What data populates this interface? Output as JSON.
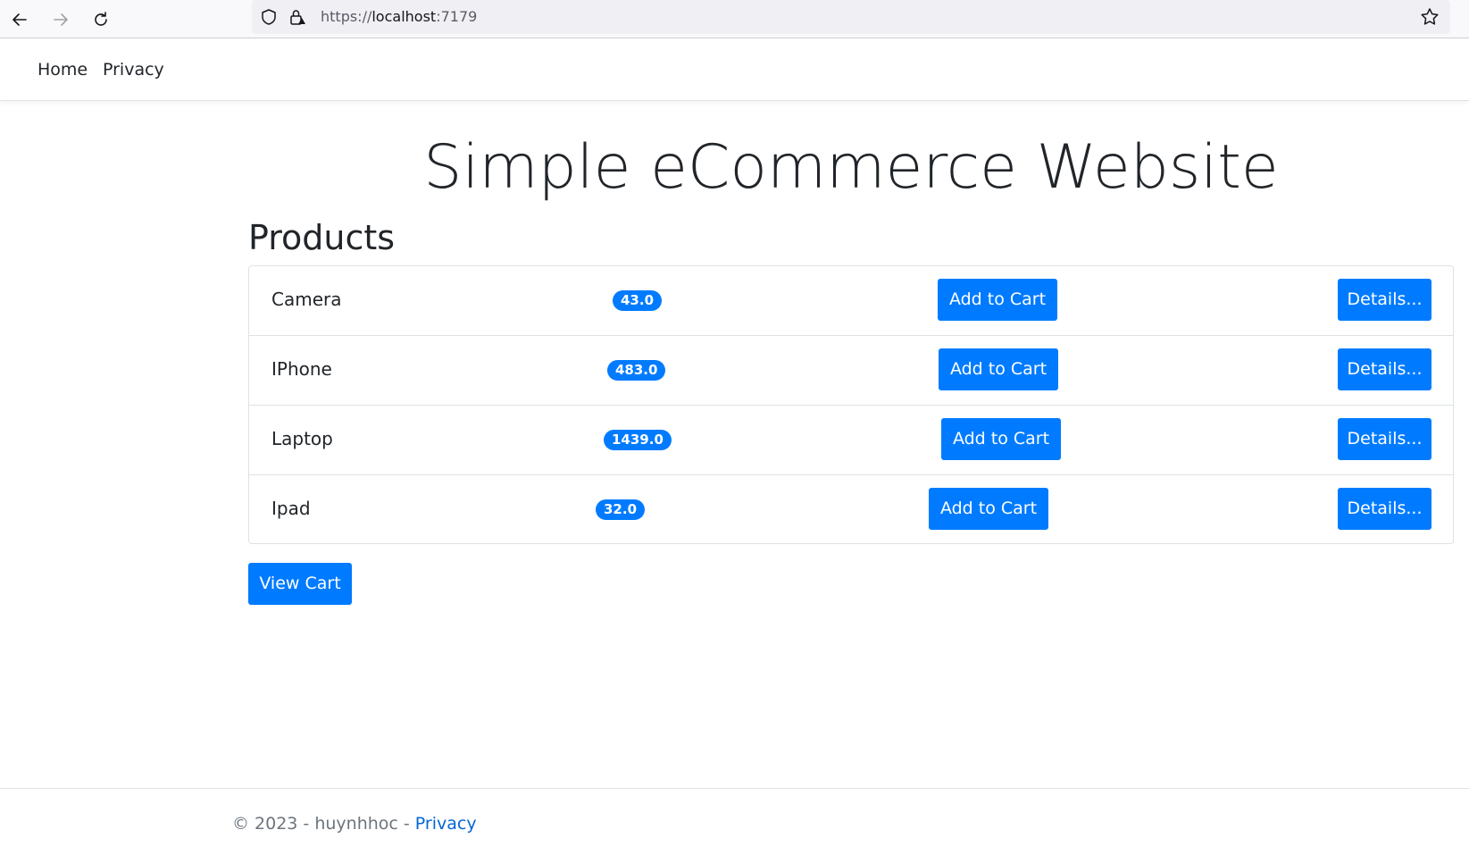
{
  "browser": {
    "url_scheme": "https://",
    "url_host": "localhost",
    "url_port": ":7179"
  },
  "navbar": {
    "links": [
      "Home",
      "Privacy"
    ]
  },
  "main": {
    "title": "Simple eCommerce Website",
    "section_title": "Products",
    "products": [
      {
        "name": "Camera",
        "price": "43.0"
      },
      {
        "name": "IPhone",
        "price": "483.0"
      },
      {
        "name": "Laptop",
        "price": "1439.0"
      },
      {
        "name": "Ipad",
        "price": "32.0"
      }
    ],
    "add_to_cart_label": "Add to Cart",
    "details_label": "Details...",
    "view_cart_label": "View Cart"
  },
  "footer": {
    "text": "© 2023 - huynhhoc - ",
    "link": "Privacy"
  },
  "colors": {
    "primary": "#007bff",
    "text": "#212529",
    "muted": "#6c757d",
    "link": "#0366d6"
  }
}
